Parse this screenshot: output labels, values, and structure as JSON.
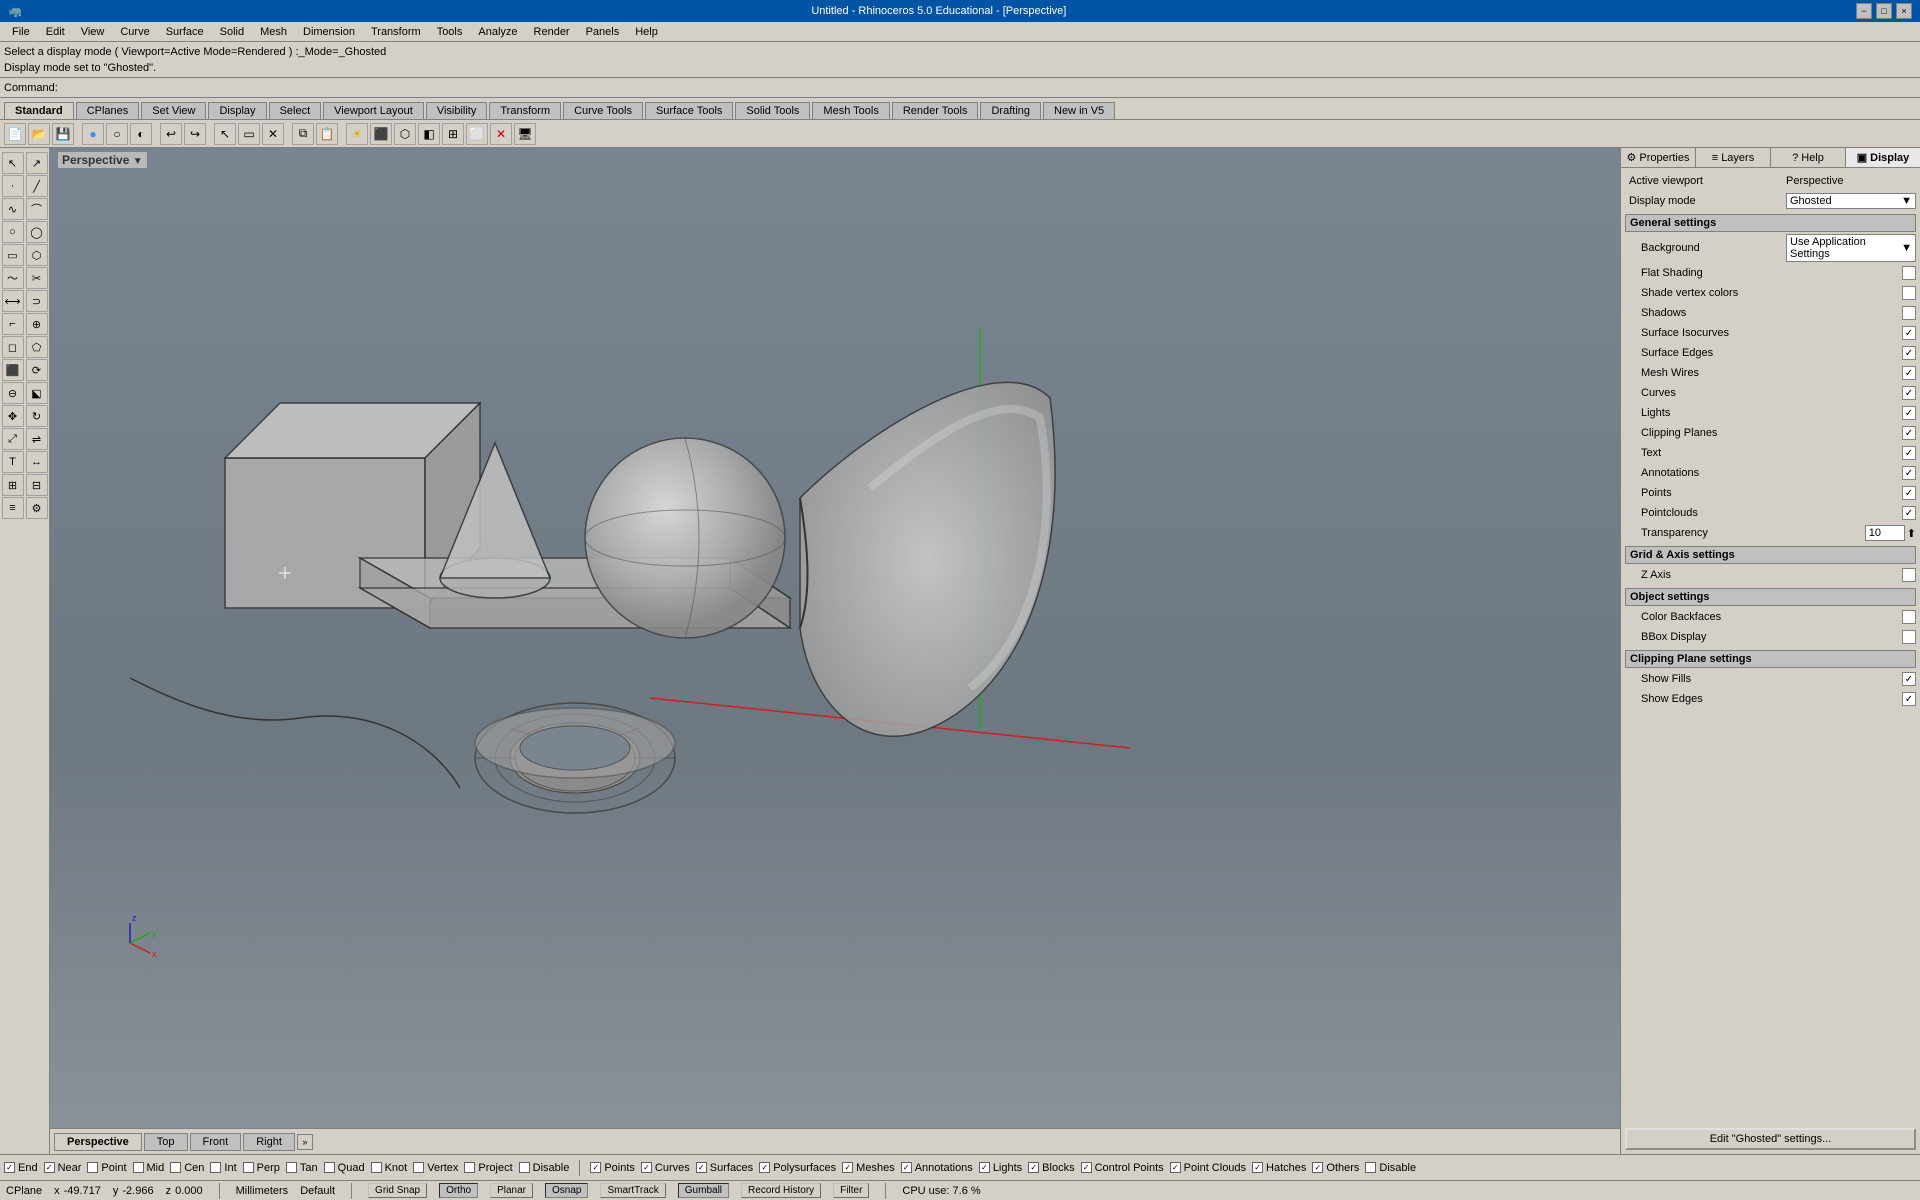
{
  "titlebar": {
    "title": "Untitled - Rhinoceros 5.0 Educational - [Perspective]",
    "min": "−",
    "max": "□",
    "close": "×"
  },
  "menubar": {
    "items": [
      "File",
      "Edit",
      "View",
      "Curve",
      "Surface",
      "Solid",
      "Mesh",
      "Dimension",
      "Transform",
      "Tools",
      "Analyze",
      "Render",
      "Panels",
      "Help"
    ]
  },
  "infobar": {
    "line1": "Select a display mode ( Viewport=Active Mode=Rendered ) :_Mode=_Ghosted",
    "line2": "Display mode set to \"Ghosted\"."
  },
  "commandbar": {
    "label": "Command:"
  },
  "toolbar_tabs": {
    "items": [
      "Standard",
      "CPlanes",
      "Set View",
      "Display",
      "Select",
      "Viewport Layout",
      "Visibility",
      "Transform",
      "Curve Tools",
      "Surface Tools",
      "Solid Tools",
      "Mesh Tools",
      "Render Tools",
      "Drafting",
      "New in V5"
    ]
  },
  "viewport": {
    "label": "Perspective",
    "tabs": [
      "Perspective",
      "Top",
      "Front",
      "Right"
    ]
  },
  "right_panel": {
    "tabs": [
      {
        "label": "Properties",
        "icon": "⚙"
      },
      {
        "label": "Layers",
        "icon": "≡"
      },
      {
        "label": "Help",
        "icon": "?"
      },
      {
        "label": "Display",
        "icon": "▣"
      }
    ],
    "active_tab": "Display",
    "display": {
      "active_viewport_label": "Active viewport",
      "active_viewport_value": "Perspective",
      "display_mode_label": "Display mode",
      "display_mode_value": "Ghosted",
      "general_settings": "General settings",
      "background_label": "Background",
      "background_value": "Use Application Settings",
      "flat_shading_label": "Flat Shading",
      "flat_shading_checked": false,
      "shade_vertex_label": "Shade vertex colors",
      "shade_vertex_checked": false,
      "shadows_label": "Shadows",
      "shadows_checked": false,
      "surface_isocurves_label": "Surface Isocurves",
      "surface_isocurves_checked": true,
      "surface_edges_label": "Surface Edges",
      "surface_edges_checked": true,
      "mesh_wires_label": "Mesh Wires",
      "mesh_wires_checked": true,
      "curves_label": "Curves",
      "curves_checked": true,
      "lights_label": "Lights",
      "lights_checked": true,
      "clipping_planes_label": "Clipping Planes",
      "clipping_planes_checked": true,
      "text_label": "Text",
      "text_checked": true,
      "annotations_label": "Annotations",
      "annotations_checked": true,
      "points_label": "Points",
      "points_checked": true,
      "pointclouds_label": "Pointclouds",
      "pointclouds_checked": true,
      "transparency_label": "Transparency",
      "transparency_value": "10",
      "grid_axis_settings": "Grid & Axis settings",
      "z_axis_label": "Z Axis",
      "z_axis_checked": false,
      "object_settings": "Object settings",
      "color_backfaces_label": "Color Backfaces",
      "color_backfaces_checked": false,
      "bbox_display_label": "BBox Display",
      "bbox_display_checked": false,
      "clipping_plane_settings": "Clipping Plane settings",
      "show_fills_label": "Show Fills",
      "show_fills_checked": true,
      "show_edges_label": "Show Edges",
      "show_edges_checked": true,
      "edit_btn_label": "Edit \"Ghosted\" settings..."
    }
  },
  "statusbar": {
    "snap_items": [
      {
        "label": "End",
        "checked": true
      },
      {
        "label": "Near",
        "checked": true
      },
      {
        "label": "Point",
        "checked": false
      },
      {
        "label": "Mid",
        "checked": false
      },
      {
        "label": "Cen",
        "checked": false
      },
      {
        "label": "Int",
        "checked": false
      },
      {
        "label": "Perp",
        "checked": false
      },
      {
        "label": "Tan",
        "checked": false
      },
      {
        "label": "Quad",
        "checked": false
      },
      {
        "label": "Knot",
        "checked": false
      },
      {
        "label": "Vertex",
        "checked": false
      },
      {
        "label": "Project",
        "checked": false
      },
      {
        "label": "Disable",
        "checked": false
      }
    ],
    "filter_items": [
      {
        "label": "Points",
        "checked": true
      },
      {
        "label": "Curves",
        "checked": true
      },
      {
        "label": "Surfaces",
        "checked": true
      },
      {
        "label": "Polysurfaces",
        "checked": true
      },
      {
        "label": "Meshes",
        "checked": true
      },
      {
        "label": "Annotations",
        "checked": true
      },
      {
        "label": "Lights",
        "checked": true
      },
      {
        "label": "Blocks",
        "checked": true
      },
      {
        "label": "Control Points",
        "checked": true
      },
      {
        "label": "Point Clouds",
        "checked": true
      },
      {
        "label": "Hatches",
        "checked": true
      },
      {
        "label": "Others",
        "checked": true
      },
      {
        "label": "Disable",
        "checked": false
      }
    ]
  },
  "coords_bar": {
    "cplane_label": "CPlane",
    "x_label": "x",
    "x_value": "-49.717",
    "y_label": "y",
    "y_value": "-2.966",
    "z_label": "z",
    "z_value": "0.000",
    "unit_label": "Millimeters",
    "default_label": "Default",
    "grid_snap_label": "Grid Snap",
    "ortho_label": "Ortho",
    "planar_label": "Planar",
    "osnap_label": "Osnap",
    "smarttrack_label": "SmartTrack",
    "gumball_label": "Gumball",
    "record_history_label": "Record History",
    "filter_label": "Filter",
    "cpu_label": "CPU use: 7.6 %"
  }
}
